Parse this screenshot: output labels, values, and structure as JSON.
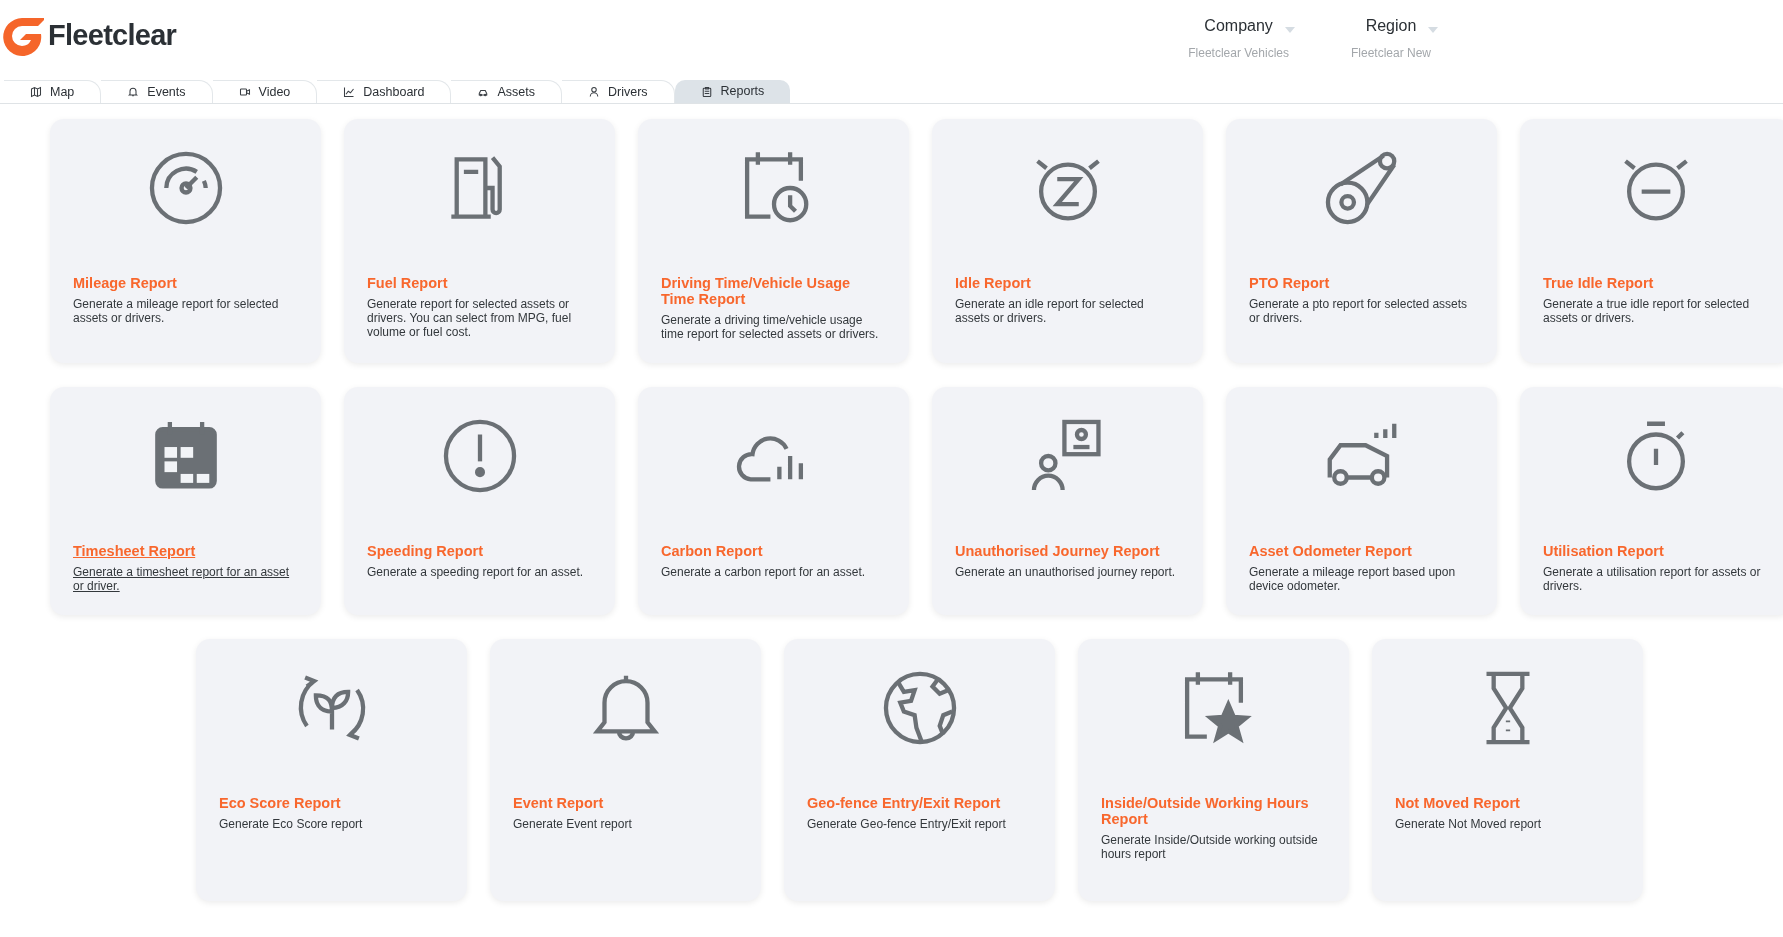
{
  "brand": {
    "name": "Fleetclear"
  },
  "selectors": [
    {
      "label": "Company",
      "value": "Fleetclear Vehicles"
    },
    {
      "label": "Region",
      "value": "Fleetclear New"
    }
  ],
  "tabs": [
    {
      "label": "Map",
      "selected": false
    },
    {
      "label": "Events",
      "selected": false
    },
    {
      "label": "Video",
      "selected": false
    },
    {
      "label": "Dashboard",
      "selected": false
    },
    {
      "label": "Assets",
      "selected": false
    },
    {
      "label": "Drivers",
      "selected": false
    },
    {
      "label": "Reports",
      "selected": true
    }
  ],
  "report_rows": [
    [
      {
        "title": "Mileage Report",
        "description": "Generate a mileage report for selected assets or drivers.",
        "hovered": false
      },
      {
        "title": "Fuel Report",
        "description": "Generate report for selected assets or drivers. You can select from MPG, fuel volume or fuel cost.",
        "hovered": false
      },
      {
        "title": "Driving Time/Vehicle Usage Time Report",
        "description": "Generate a driving time/vehicle usage time report for selected assets or drivers.",
        "hovered": false
      },
      {
        "title": "Idle Report",
        "description": "Generate an idle report for selected assets or drivers.",
        "hovered": false
      },
      {
        "title": "PTO Report",
        "description": "Generate a pto report for selected assets or drivers.",
        "hovered": false
      },
      {
        "title": "True Idle Report",
        "description": "Generate a true idle report for selected assets or drivers.",
        "hovered": false
      }
    ],
    [
      {
        "title": "Timesheet Report",
        "description": "Generate a timesheet report for an asset or driver.",
        "hovered": true
      },
      {
        "title": "Speeding Report",
        "description": "Generate a speeding report for an asset.",
        "hovered": false
      },
      {
        "title": "Carbon Report",
        "description": "Generate a carbon report for an asset.",
        "hovered": false
      },
      {
        "title": "Unauthorised Journey Report",
        "description": "Generate an unauthorised journey report.",
        "hovered": false
      },
      {
        "title": "Asset Odometer Report",
        "description": "Generate a mileage report based upon device odometer.",
        "hovered": false
      },
      {
        "title": "Utilisation Report",
        "description": "Generate a utilisation report for assets or drivers.",
        "hovered": false
      }
    ],
    [
      {
        "title": "Eco Score Report",
        "description": "Generate Eco Score report",
        "hovered": false
      },
      {
        "title": "Event Report",
        "description": "Generate Event report",
        "hovered": false
      },
      {
        "title": "Geo-fence Entry/Exit Report",
        "description": "Generate Geo-fence Entry/Exit report",
        "hovered": false
      },
      {
        "title": "Inside/Outside Working Hours Report",
        "description": "Generate Inside/Outside working outside hours report",
        "hovered": false
      },
      {
        "title": "Not Moved Report",
        "description": "Generate Not Moved report",
        "hovered": false
      }
    ]
  ]
}
